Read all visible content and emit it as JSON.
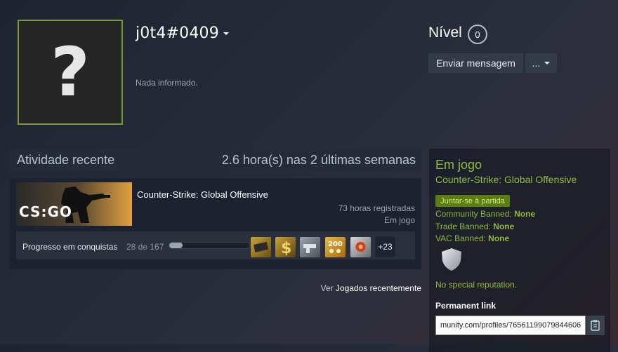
{
  "profile": {
    "persona_name": "j0t4#0409",
    "summary": "Nada informado.",
    "avatar_placeholder": "?"
  },
  "level": {
    "label": "Nível",
    "value": "0"
  },
  "actions": {
    "send_message": "Enviar mensagem",
    "more": "..."
  },
  "recent_activity": {
    "title": "Atividade recente",
    "hours_summary": "2.6 hora(s) nas 2 últimas semanas",
    "game": {
      "name": "Counter-Strike: Global Offensive",
      "banner_text": "CS:GO",
      "hours": "73 horas registradas",
      "status": "Em jogo"
    },
    "achievements": {
      "label": "Progresso em conquistas",
      "count": "28 de 167",
      "progress_fraction": 0.168,
      "icons": [
        "achievement-1-icon",
        "achievement-2-icon",
        "achievement-3-icon",
        "achievement-4-icon",
        "achievement-5-icon"
      ],
      "more": "+23"
    },
    "see_recent_prefix": "Ver",
    "see_recent_link": "Jogados recentemente"
  },
  "in_game": {
    "title": "Em jogo",
    "game": "Counter-Strike: Global Offensive",
    "join_button": "Juntar-se à partida"
  },
  "bans": {
    "community_label": "Community Banned:",
    "community_value": "None",
    "trade_label": "Trade Banned:",
    "trade_value": "None",
    "vac_label": "VAC Banned:",
    "vac_value": "None"
  },
  "reputation": "No special reputation.",
  "permanent_link": {
    "label": "Permanent link",
    "value": "munity.com/profiles/76561199079844606"
  },
  "colors": {
    "accent_green": "#90ba3c",
    "join_button": "#5c7e10",
    "avatar_border": "#7a9a3a"
  }
}
